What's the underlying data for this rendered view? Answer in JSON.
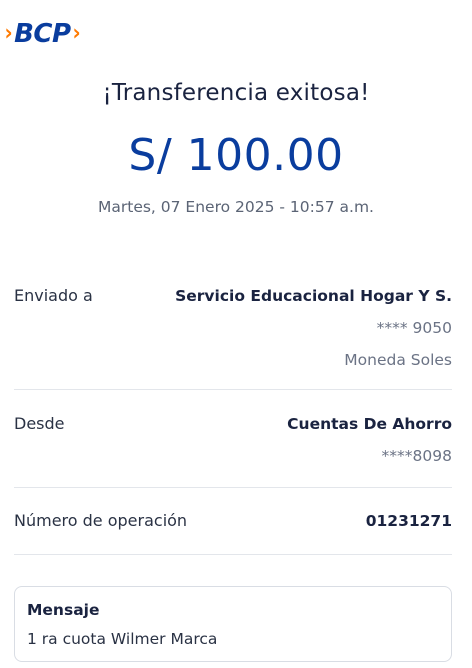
{
  "brand": {
    "name": "BCP",
    "chevron_left": "›",
    "chevron_right": "›",
    "colors": {
      "primary": "#0a3d9e",
      "accent": "#ff7a00"
    }
  },
  "header": {
    "title": "¡Transferencia exitosa!",
    "amount": "S/ 100.00",
    "datetime": "Martes, 07 Enero 2025 - 10:57 a.m."
  },
  "details": {
    "sent_to": {
      "label": "Enviado a",
      "name": "Servicio Educacional Hogar Y S.",
      "account": "**** 9050",
      "currency": "Moneda Soles"
    },
    "from": {
      "label": "Desde",
      "account_type": "Cuentas De Ahorro",
      "account": "****8098"
    },
    "operation": {
      "label": "Número de operación",
      "value": "01231271"
    }
  },
  "message": {
    "label": "Mensaje",
    "text": "1 ra cuota Wilmer Marca"
  }
}
